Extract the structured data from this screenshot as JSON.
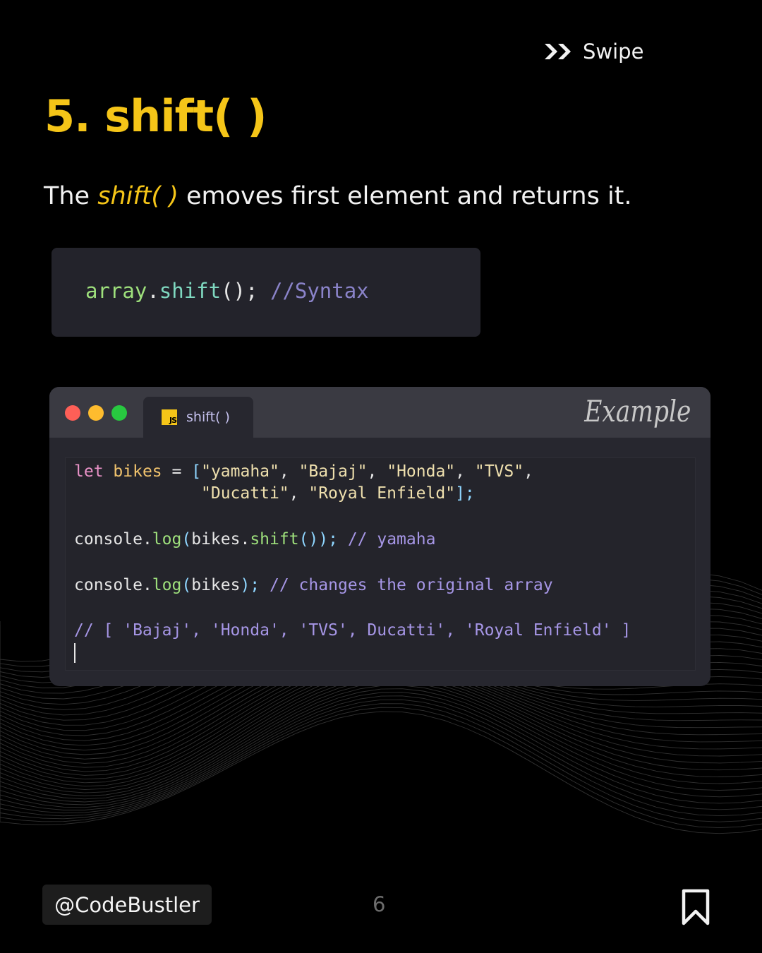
{
  "header": {
    "swipe_label": "Swipe"
  },
  "slide": {
    "title": "5. shift( )",
    "description_prefix": "The ",
    "description_highlight": "shift( )",
    "description_suffix": " emoves first element and returns it."
  },
  "syntax_box": {
    "object": "array",
    "dot": ".",
    "method": "shift",
    "punct": "();",
    "comment": "//Syntax"
  },
  "editor": {
    "tab_label": "shift( )",
    "tab_icon": "JS",
    "corner_label": "Example",
    "code": {
      "l1": {
        "kw": "let",
        "var": "bikes",
        "op": "=",
        "open": "[",
        "s1": "\"yamaha\"",
        "s2": "\"Bajaj\"",
        "s3": "\"Honda\"",
        "s4": "\"TVS\""
      },
      "l2": {
        "s5": "\"Ducatti\"",
        "s6": "\"Royal Enfield\"",
        "close": "];"
      },
      "l3": {
        "obj": "console",
        "fn": "log",
        "arg": "bikes",
        "inner_fn": "shift",
        "end": "());",
        "comment": "// yamaha"
      },
      "l4": {
        "obj": "console",
        "fn": "log",
        "arg": "bikes",
        "end": ");",
        "comment": "// changes the original array"
      },
      "l5": {
        "comment": "// [ 'Bajaj', 'Honda', 'TVS', Ducatti', 'Royal Enfield' ]"
      }
    }
  },
  "footer": {
    "handle": "@CodeBustler",
    "page_number": "6"
  },
  "colors": {
    "accent": "#f5c518",
    "background": "#000000",
    "editor_bg": "#27272f",
    "syntax_bg": "#23232b"
  },
  "icons": [
    "double-chevron-right-icon",
    "js-file-icon",
    "bookmark-icon"
  ]
}
